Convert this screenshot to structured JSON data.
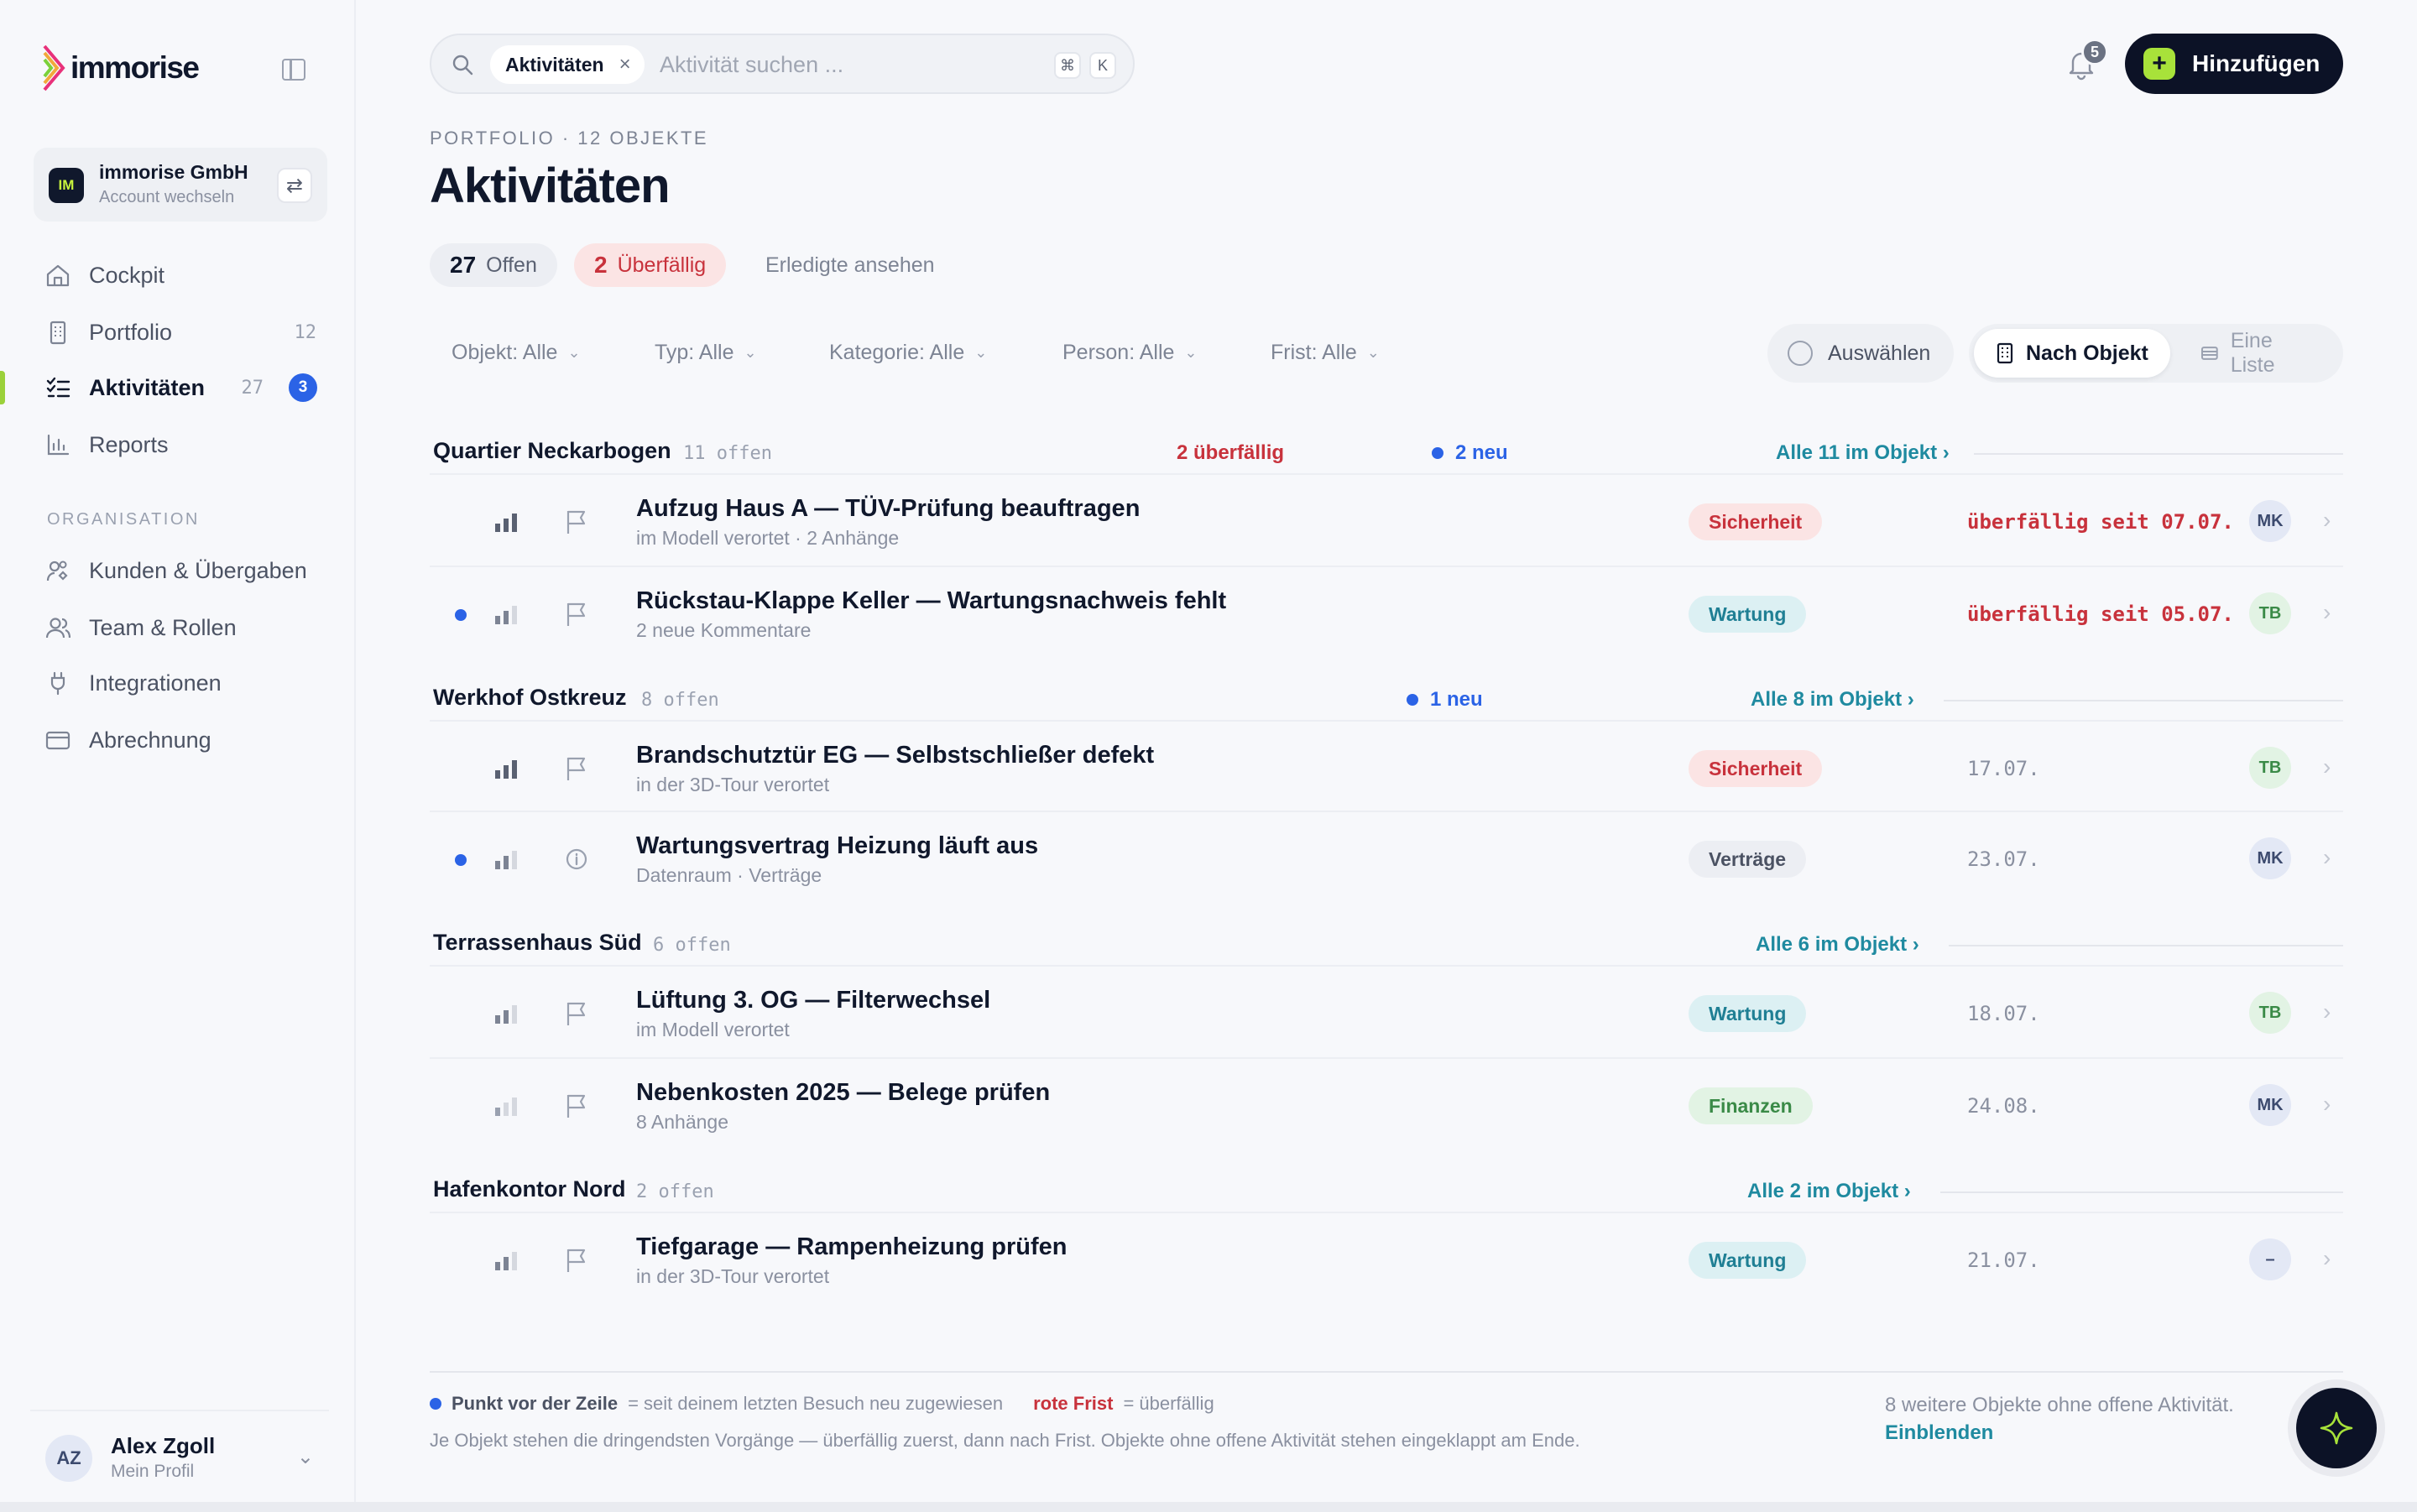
{
  "brand": {
    "name": "immorise"
  },
  "account": {
    "badge": "IM",
    "name": "immorise GmbH",
    "sub": "Account wechseln"
  },
  "nav": {
    "items": [
      {
        "label": "Cockpit",
        "icon": "home-icon"
      },
      {
        "label": "Portfolio",
        "icon": "building-icon",
        "count": "12"
      },
      {
        "label": "Aktivitäten",
        "icon": "checklist-icon",
        "count": "27",
        "badge": "3"
      },
      {
        "label": "Reports",
        "icon": "bar-chart-icon"
      }
    ],
    "section_label": "ORGANISATION",
    "org_items": [
      {
        "label": "Kunden & Übergaben",
        "icon": "users-icon"
      },
      {
        "label": "Team & Rollen",
        "icon": "team-icon"
      },
      {
        "label": "Integrationen",
        "icon": "plug-icon"
      },
      {
        "label": "Abrechnung",
        "icon": "credit-card-icon"
      }
    ]
  },
  "profile": {
    "initials": "AZ",
    "name": "Alex Zgoll",
    "sub": "Mein Profil"
  },
  "search": {
    "chip": "Aktivitäten",
    "placeholder": "Aktivität suchen ...",
    "kbd1": "⌘",
    "kbd2": "K"
  },
  "notifications": {
    "count": "5"
  },
  "add_button": {
    "label": "Hinzufügen"
  },
  "header": {
    "eyebrow": "PORTFOLIO · 12 OBJEKTE",
    "title": "Aktivitäten",
    "open_count": "27",
    "open_label": "Offen",
    "overdue_count": "2",
    "overdue_label": "Überfällig",
    "done_link": "Erledigte ansehen"
  },
  "filters": [
    {
      "label": "Objekt: Alle"
    },
    {
      "label": "Typ: Alle"
    },
    {
      "label": "Kategorie: Alle"
    },
    {
      "label": "Person: Alle"
    },
    {
      "label": "Frist: Alle"
    }
  ],
  "select_button": "Auswählen",
  "view_toggle": {
    "on": "Nach Objekt",
    "off": "Eine Liste"
  },
  "groups": [
    {
      "name": "Quartier Neckarbogen",
      "open": "11 offen",
      "overdue": "2 überfällig",
      "new": "2 neu",
      "all": "Alle 11 im Objekt"
    },
    {
      "name": "Werkhof Ostkreuz",
      "open": "8 offen",
      "new": "1 neu",
      "all": "Alle 8 im Objekt"
    },
    {
      "name": "Terrassenhaus Süd",
      "open": "6 offen",
      "all": "Alle 6 im Objekt"
    },
    {
      "name": "Hafenkontor Nord",
      "open": "2 offen",
      "all": "Alle 2 im Objekt"
    }
  ],
  "rows": [
    {
      "title": "Aufzug Haus A — TÜV-Prüfung beauftragen",
      "sub": "im Modell verortet · 2 Anhänge",
      "tag": "Sicherheit",
      "due": "überfällig seit 07.07.",
      "person": "MK",
      "priority": 3,
      "is_new": false,
      "icon": "flag-icon"
    },
    {
      "title": "Rückstau-Klappe Keller — Wartungsnachweis fehlt",
      "sub": "2 neue Kommentare",
      "tag": "Wartung",
      "due": "überfällig seit 05.07.",
      "person": "TB",
      "priority": 2,
      "is_new": true,
      "icon": "flag-icon"
    },
    {
      "title": "Brandschutztür EG — Selbstschließer defekt",
      "sub": "in der 3D-Tour verortet",
      "tag": "Sicherheit",
      "due": "17.07.",
      "person": "TB",
      "priority": 3,
      "is_new": false,
      "icon": "flag-icon"
    },
    {
      "title": "Wartungsvertrag Heizung läuft aus",
      "sub": "Datenraum · Verträge",
      "tag": "Verträge",
      "due": "23.07.",
      "person": "MK",
      "priority": 2,
      "is_new": true,
      "icon": "info-icon"
    },
    {
      "title": "Lüftung 3. OG — Filterwechsel",
      "sub": "im Modell verortet",
      "tag": "Wartung",
      "due": "18.07.",
      "person": "TB",
      "priority": 2,
      "is_new": false,
      "icon": "flag-icon"
    },
    {
      "title": "Nebenkosten 2025 — Belege prüfen",
      "sub": "8 Anhänge",
      "tag": "Finanzen",
      "due": "24.08.",
      "person": "MK",
      "priority": 1,
      "is_new": false,
      "icon": "flag-icon"
    },
    {
      "title": "Tiefgarage — Rampenheizung prüfen",
      "sub": "in der 3D-Tour verortet",
      "tag": "Wartung",
      "due": "21.07.",
      "person": "–",
      "priority": 2,
      "is_new": false,
      "icon": "flag-icon"
    }
  ],
  "footer": {
    "legend_dot_label": "Punkt vor der Zeile",
    "legend_dot_text": "= seit deinem letzten Besuch neu zugewiesen",
    "legend_red_label": "rote Frist",
    "legend_red_text": "= überfällig",
    "note": "Je Objekt stehen die dringendsten Vorgänge — überfällig zuerst, dann nach Frist. Objekte ohne offene Aktivität stehen eingeklappt am Ende.",
    "more_text": "8 weitere Objekte ohne offene Aktivität.",
    "more_link": "Einblenden"
  },
  "colors": {
    "accent": "#a8e23a",
    "dark": "#0c1226",
    "overdue": "#c8323c",
    "new": "#2b63e6",
    "link": "#1f8aa0"
  }
}
